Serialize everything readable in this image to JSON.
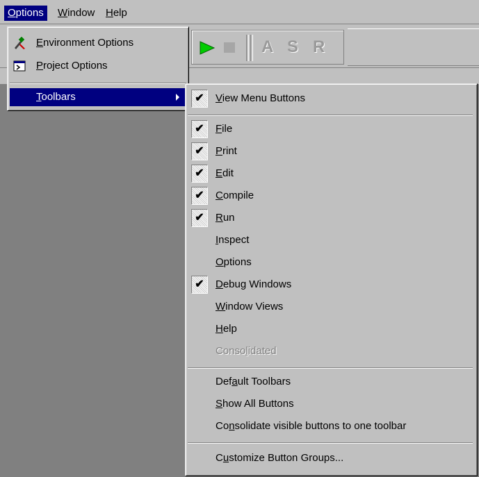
{
  "menubar": {
    "items": [
      {
        "pre": "",
        "u": "O",
        "post": "ptions"
      },
      {
        "pre": "",
        "u": "W",
        "post": "indow"
      },
      {
        "pre": "",
        "u": "H",
        "post": "elp"
      }
    ]
  },
  "toolbar": {
    "letters": [
      "A",
      "S",
      "R"
    ],
    "play_color": "#00cc00"
  },
  "options_menu": {
    "items": [
      {
        "icon": "environment-options-icon",
        "pre": "",
        "u": "E",
        "post": "nvironment Options"
      },
      {
        "icon": "project-options-icon",
        "pre": "",
        "u": "P",
        "post": "roject Options"
      },
      {
        "pre": "",
        "u": "T",
        "post": "oolbars"
      }
    ]
  },
  "toolbars_menu": {
    "items": [
      {
        "pre": "",
        "u": "V",
        "post": "iew Menu Buttons",
        "checked": true
      },
      {
        "pre": "",
        "u": "F",
        "post": "ile",
        "checked": true
      },
      {
        "pre": "",
        "u": "P",
        "post": "rint",
        "checked": true
      },
      {
        "pre": "",
        "u": "E",
        "post": "dit",
        "checked": true
      },
      {
        "pre": "",
        "u": "C",
        "post": "ompile",
        "checked": true
      },
      {
        "pre": "",
        "u": "R",
        "post": "un",
        "checked": true
      },
      {
        "pre": "",
        "u": "I",
        "post": "nspect",
        "checked": false
      },
      {
        "pre": "",
        "u": "O",
        "post": "ptions",
        "checked": false
      },
      {
        "pre": "",
        "u": "D",
        "post": "ebug Windows",
        "checked": true
      },
      {
        "pre": "",
        "u": "W",
        "post": "indow Views",
        "checked": false
      },
      {
        "pre": "",
        "u": "H",
        "post": "elp",
        "checked": false
      },
      {
        "pre": "Conso",
        "u": "l",
        "post": "idated",
        "checked": false,
        "disabled": true
      },
      {
        "pre": "Def",
        "u": "a",
        "post": "ult Toolbars"
      },
      {
        "pre": "",
        "u": "S",
        "post": "how All Buttons"
      },
      {
        "pre": "Co",
        "u": "n",
        "post": "solidate visible buttons to one toolbar"
      },
      {
        "pre": "C",
        "u": "u",
        "post": "stomize Button Groups..."
      }
    ],
    "checkmark": "✔"
  },
  "colors": {
    "menu_bg": "#c0c0c0",
    "highlight": "#000080",
    "desktop": "#808080"
  }
}
